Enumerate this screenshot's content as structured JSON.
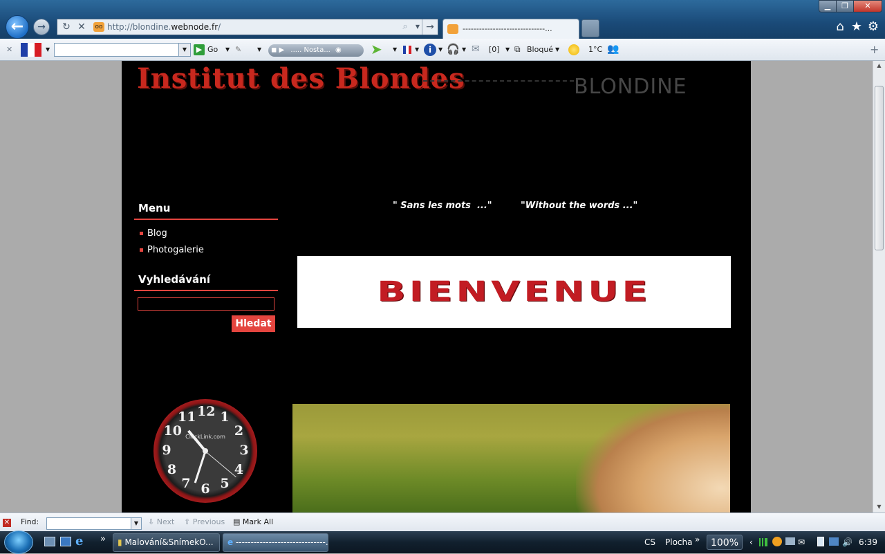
{
  "browser": {
    "url_prefix": "http://blondine.",
    "url_domain": "webnode.fr",
    "url_suffix": "/",
    "tab_title": "------------------------------...",
    "back_glyph": "←",
    "forward_glyph": "→",
    "refresh_glyph": "↻",
    "stop_glyph": "✕",
    "go_glyph": "→",
    "search_glyph": "⌕",
    "home_glyph": "⌂",
    "favorites_glyph": "★",
    "tools_glyph": "⚙",
    "minimize_glyph": "▁",
    "maximize_glyph": "❐",
    "close_glyph": "✕",
    "favicon_text": "oo"
  },
  "toolbar": {
    "close_glyph": "✕",
    "go_label": "Go",
    "radio_label": "..... Nosta...",
    "count_label": "[0]",
    "popup_label": "Bloqué",
    "temperature": "1°C",
    "add_glyph": "+",
    "dropdown_glyph": "▼"
  },
  "site": {
    "title": "Institut des Blondes",
    "subtitle": "BLONDINE",
    "menu_heading": "Menu",
    "menu_items": [
      "Blog",
      "Photogalerie"
    ],
    "search_heading": "Vyhledávání",
    "search_button": "Hledat",
    "quote_fr": "\" Sans les mots  ...\"",
    "quote_en": "\"Without the words ...\"",
    "banner_text": "BIENVENUE",
    "clock_brand": "ClockLink.com",
    "clock_numbers": [
      "12",
      "1",
      "2",
      "3",
      "4",
      "5",
      "6",
      "7",
      "8",
      "9",
      "10",
      "11"
    ],
    "accent_color": "#e4453f"
  },
  "findbar": {
    "label": "Find:",
    "next": "Next",
    "previous": "Previous",
    "mark_all": "Mark All"
  },
  "taskbar": {
    "task1": "Malování&SnímekO...",
    "task2": "------------------------------...",
    "lang": "CS",
    "desktop": "Plocha",
    "zoom": "100%",
    "time": "6:39",
    "overflow_glyph": "»"
  }
}
